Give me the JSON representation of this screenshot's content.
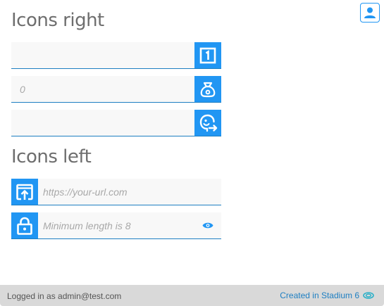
{
  "header": {
    "user_icon": "user-icon"
  },
  "sections": {
    "icons_right_title": "Icons right",
    "icons_left_title": "Icons left"
  },
  "fields_right": [
    {
      "value": "",
      "placeholder": "",
      "icon": "number-one-icon"
    },
    {
      "value": "",
      "placeholder": "0",
      "icon": "money-bag-icon"
    },
    {
      "value": "",
      "placeholder": "",
      "icon": "face-arrow-icon"
    }
  ],
  "fields_left": [
    {
      "value": "",
      "placeholder": "https://your-url.com",
      "icon": "open-in-browser-icon"
    },
    {
      "value": "",
      "placeholder": "Minimum length is 8",
      "icon": "lock-icon",
      "trailing_icon": "eye-icon"
    }
  ],
  "footer": {
    "login_text": "Logged in as admin@test.com",
    "credit_text": "Created in Stadium 6",
    "credit_icon": "stadium-logo-icon"
  },
  "colors": {
    "accent": "#2196f3",
    "underline": "#1e7fc2",
    "title": "#6e6e6e",
    "field_bg": "#f8f8f8",
    "footer_bg": "#d9d9d9"
  }
}
